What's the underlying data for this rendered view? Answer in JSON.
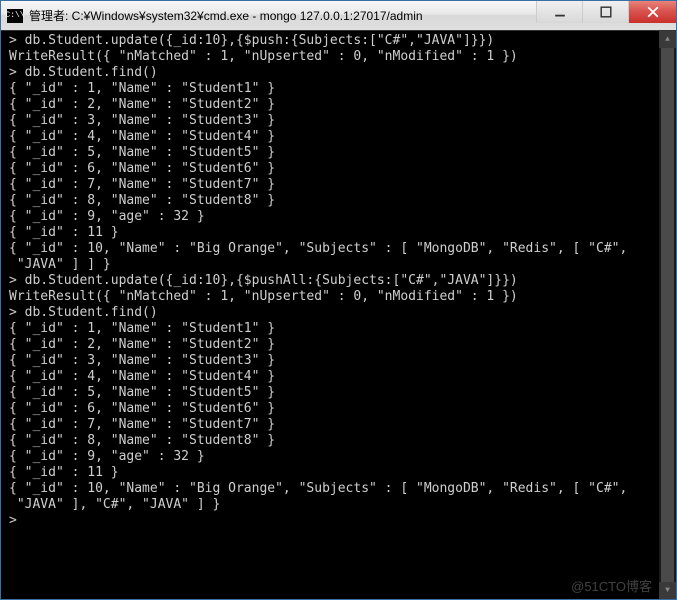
{
  "window": {
    "title": "管理者: C:¥Windows¥system32¥cmd.exe - mongo  127.0.0.1:27017/admin"
  },
  "terminal": {
    "lines": [
      "> db.Student.update({_id:10},{$push:{Subjects:[\"C#\",\"JAVA\"]}})",
      "WriteResult({ \"nMatched\" : 1, \"nUpserted\" : 0, \"nModified\" : 1 })",
      "> db.Student.find()",
      "{ \"_id\" : 1, \"Name\" : \"Student1\" }",
      "{ \"_id\" : 2, \"Name\" : \"Student2\" }",
      "{ \"_id\" : 3, \"Name\" : \"Student3\" }",
      "{ \"_id\" : 4, \"Name\" : \"Student4\" }",
      "{ \"_id\" : 5, \"Name\" : \"Student5\" }",
      "{ \"_id\" : 6, \"Name\" : \"Student6\" }",
      "{ \"_id\" : 7, \"Name\" : \"Student7\" }",
      "{ \"_id\" : 8, \"Name\" : \"Student8\" }",
      "{ \"_id\" : 9, \"age\" : 32 }",
      "{ \"_id\" : 11 }",
      "{ \"_id\" : 10, \"Name\" : \"Big Orange\", \"Subjects\" : [ \"MongoDB\", \"Redis\", [ \"C#\",",
      " \"JAVA\" ] ] }",
      "> db.Student.update({_id:10},{$pushAll:{Subjects:[\"C#\",\"JAVA\"]}})",
      "WriteResult({ \"nMatched\" : 1, \"nUpserted\" : 0, \"nModified\" : 1 })",
      "> db.Student.find()",
      "{ \"_id\" : 1, \"Name\" : \"Student1\" }",
      "{ \"_id\" : 2, \"Name\" : \"Student2\" }",
      "{ \"_id\" : 3, \"Name\" : \"Student3\" }",
      "{ \"_id\" : 4, \"Name\" : \"Student4\" }",
      "{ \"_id\" : 5, \"Name\" : \"Student5\" }",
      "{ \"_id\" : 6, \"Name\" : \"Student6\" }",
      "{ \"_id\" : 7, \"Name\" : \"Student7\" }",
      "{ \"_id\" : 8, \"Name\" : \"Student8\" }",
      "{ \"_id\" : 9, \"age\" : 32 }",
      "{ \"_id\" : 11 }",
      "{ \"_id\" : 10, \"Name\" : \"Big Orange\", \"Subjects\" : [ \"MongoDB\", \"Redis\", [ \"C#\",",
      " \"JAVA\" ], \"C#\", \"JAVA\" ] }",
      ">"
    ]
  },
  "watermark": "@51CTO博客"
}
